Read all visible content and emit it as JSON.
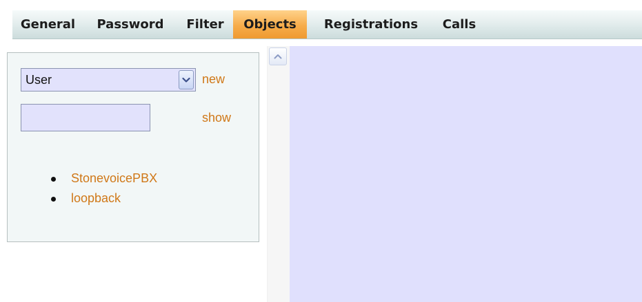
{
  "tabs": [
    {
      "label": "General"
    },
    {
      "label": "Password"
    },
    {
      "label": "Filter"
    },
    {
      "label": "Objects",
      "active": true
    },
    {
      "label": "Registrations"
    },
    {
      "label": "Calls"
    }
  ],
  "left_panel": {
    "object_type_select": {
      "value": "User"
    },
    "new_link": "new",
    "search_input": {
      "value": ""
    },
    "show_link": "show",
    "objects": [
      {
        "label": "StonevoicePBX"
      },
      {
        "label": "loopback"
      }
    ]
  },
  "colors": {
    "active_tab": "#f6ac4a",
    "link": "#d07818",
    "input_background": "#e2e2fc",
    "content_background": "#e0e0fd"
  },
  "icons": {
    "select_arrow": "chevron-down-icon",
    "scroll_up": "arrow-up-icon",
    "bullet": "bullet-icon"
  }
}
